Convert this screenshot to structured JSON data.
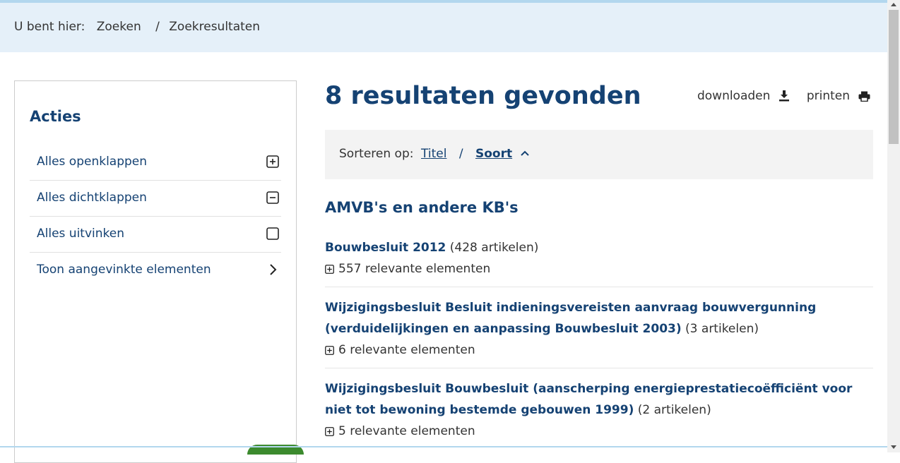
{
  "breadcrumb": {
    "prefix": "U bent hier:",
    "items": [
      "Zoeken",
      "Zoekresultaten"
    ],
    "separator": "/"
  },
  "sidebar": {
    "title": "Acties",
    "items": [
      {
        "label": "Alles openklappen",
        "icon": "plus-square-icon"
      },
      {
        "label": "Alles dichtklappen",
        "icon": "minus-square-icon"
      },
      {
        "label": "Alles uitvinken",
        "icon": "checkbox-icon"
      },
      {
        "label": "Toon aangevinkte elementen",
        "icon": "chevron-right-icon"
      }
    ]
  },
  "main": {
    "title": "8 resultaten gevonden",
    "tools": {
      "download_label": "downloaden",
      "download_icon": "download-icon",
      "print_label": "printen",
      "print_icon": "printer-icon"
    },
    "sort": {
      "label": "Sorteren op:",
      "options": [
        "Titel",
        "Soort"
      ],
      "active": "Soort",
      "separator": "/",
      "direction_icon": "chevron-up-icon"
    },
    "section_title": "AMVB's en andere KB's",
    "results": [
      {
        "title": "Bouwbesluit 2012",
        "count": "(428 artikelen)",
        "relevant": "557 relevante elementen"
      },
      {
        "title": "Wijzigingsbesluit Besluit indieningsvereisten aanvraag bouwvergunning (verduidelijkingen en aanpassing Bouwbesluit 2003)",
        "count": "(3 artikelen)",
        "relevant": "6 relevante elementen"
      },
      {
        "title": "Wijzigingsbesluit Bouwbesluit (aanscherping energieprestatiecoëfficiënt voor niet tot bewoning bestemde gebouwen 1999)",
        "count": "(2 artikelen)",
        "relevant": "5 relevante elementen"
      }
    ]
  },
  "colors": {
    "brand": "#154273",
    "breadcrumb_bg": "#e5f0f9",
    "sort_bg": "#f3f3f3"
  }
}
